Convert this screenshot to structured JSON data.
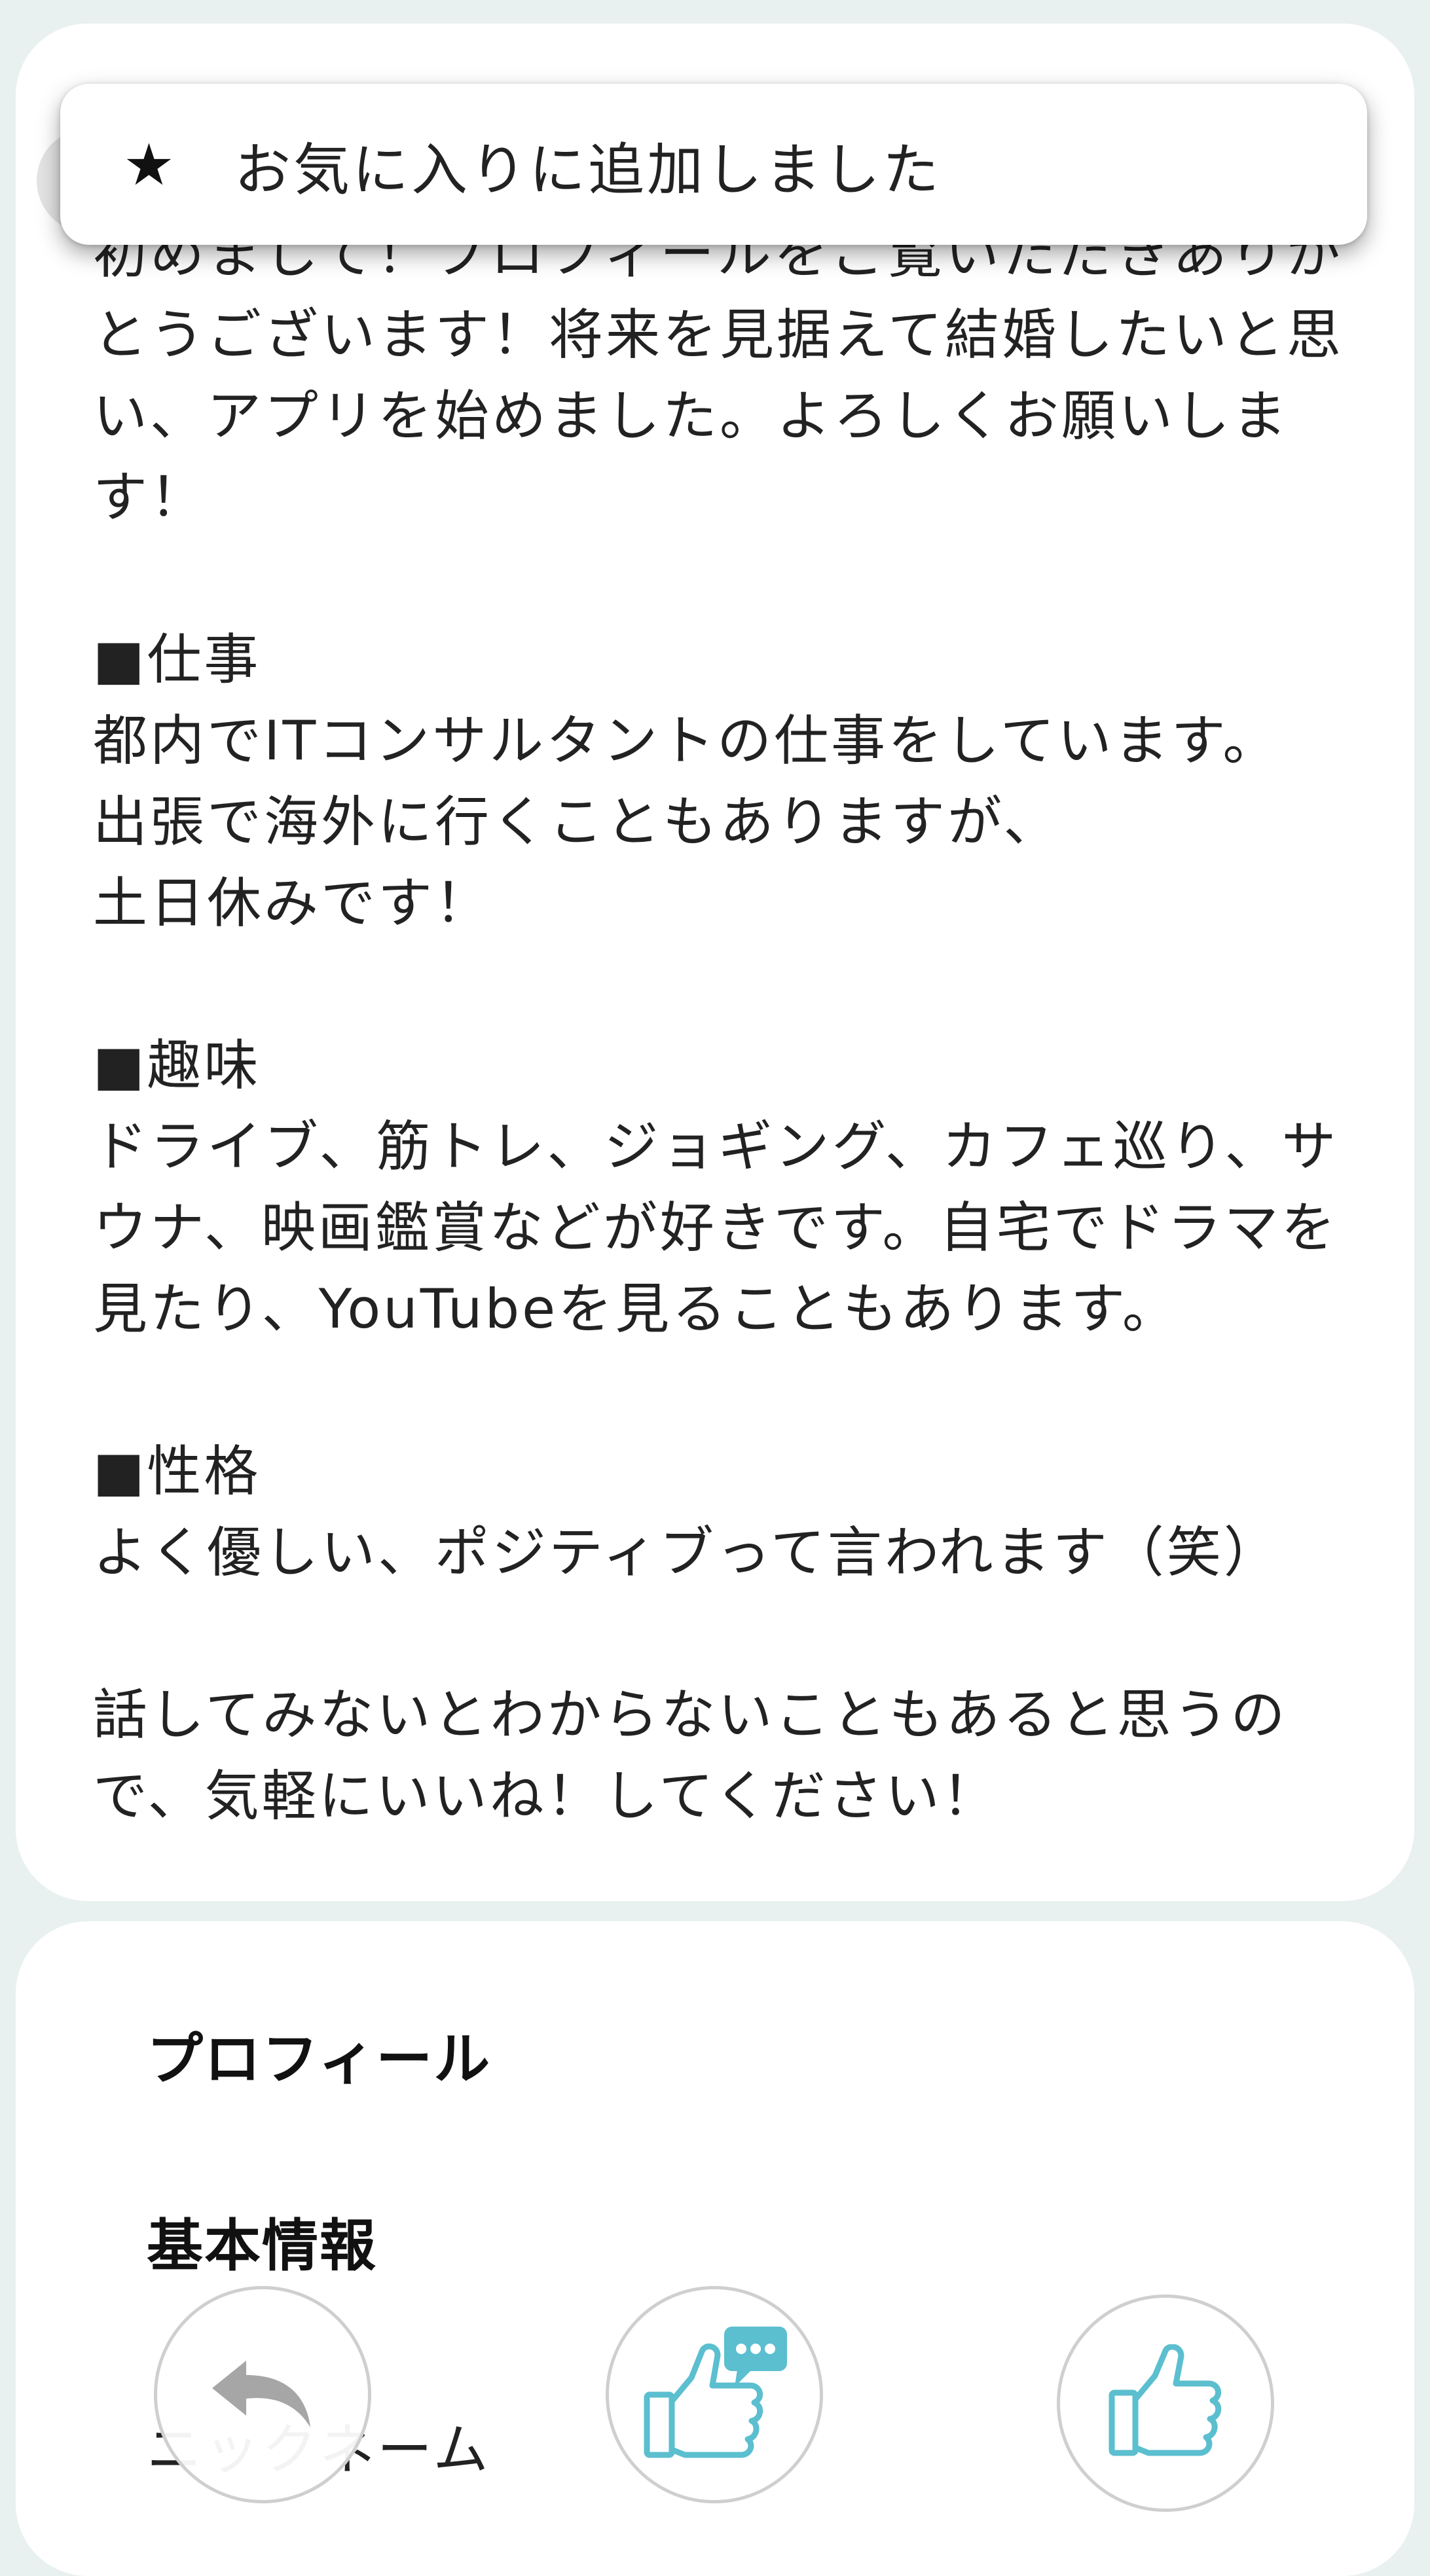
{
  "toast": {
    "icon": "star-icon",
    "message": "お気に入りに追加しました"
  },
  "intro": {
    "paragraphs": [
      "初めまして！プロフィールをご覧いただきありがとうございます！将来を見据えて結婚したいと思い、アプリを始めました。よろしくお願いします！",
      "■仕事\n都内でITコンサルタントの仕事をしています。\n出張で海外に行くこともありますが、\n土日休みです！",
      "■趣味\nドライブ、筋トレ、ジョギング、カフェ巡り、サウナ、映画鑑賞などが好きです。自宅でドラマを見たり、YouTubeを見ることもあります。",
      "■性格\nよく優しい、ポジティブって言われます（笑）",
      "話してみないとわからないこともあると思うので、気軽にいいね！してください！"
    ]
  },
  "profile": {
    "title": "プロフィール",
    "basic_info_title": "基本情報",
    "first_field_label": "ニックネーム"
  },
  "actions": [
    {
      "name": "back-button",
      "icon": "undo-arrow-icon"
    },
    {
      "name": "like-with-message-button",
      "icon": "thumbs-up-message-icon"
    },
    {
      "name": "like-button",
      "icon": "thumbs-up-icon"
    }
  ],
  "colors": {
    "accent": "#5bbfcf",
    "muted_icon": "#a6a6a6",
    "background": "#e9f0f0"
  }
}
